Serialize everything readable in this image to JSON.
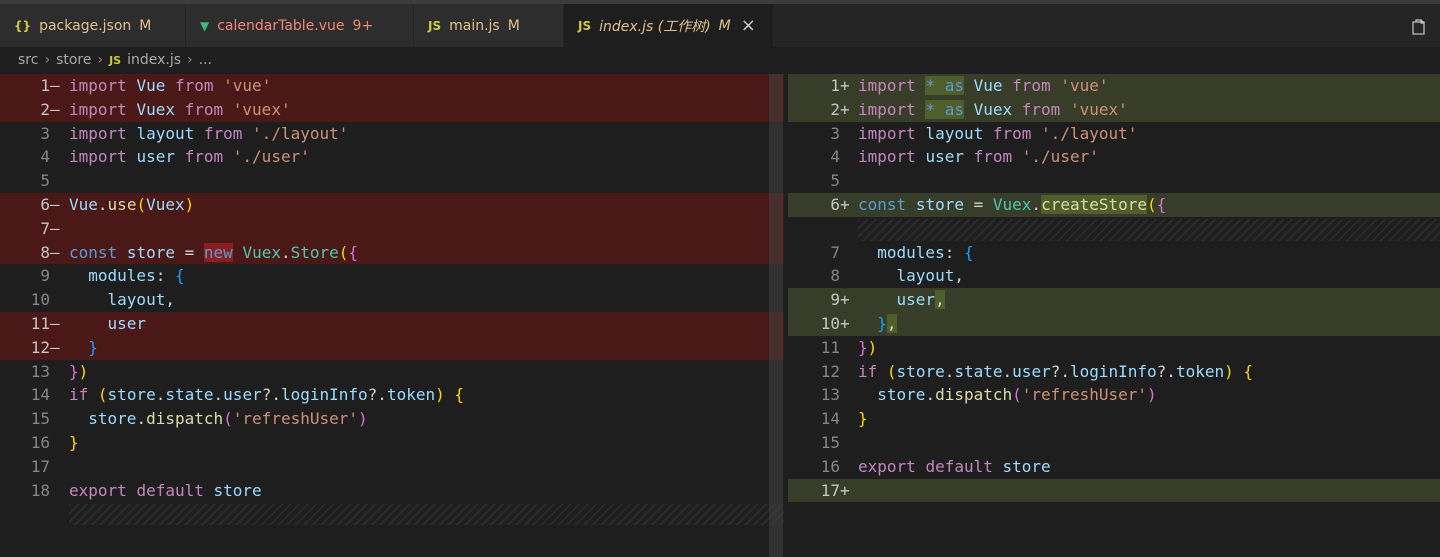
{
  "tabs": [
    {
      "icon": "{}",
      "label": "package.json",
      "status": "M",
      "icon_color": "#cbcb41",
      "label_color": "#e2c08d",
      "status_color": "#e2c08d"
    },
    {
      "icon": "▼",
      "label": "calendarTable.vue",
      "status": "9+",
      "icon_color": "#41b883",
      "label_color": "#f48771",
      "status_color": "#f48771"
    },
    {
      "icon": "JS",
      "label": "main.js",
      "status": "M",
      "icon_color": "#cbcb41",
      "label_color": "#e2c08d",
      "status_color": "#e2c08d"
    },
    {
      "icon": "JS",
      "label": "index.js (工作树)",
      "status": "M",
      "icon_color": "#cbcb41",
      "label_color": "#e2c08d",
      "status_color": "#e2c08d",
      "close": "×"
    }
  ],
  "breadcrumb": {
    "parts": [
      "src",
      "store"
    ],
    "file_icon": "JS",
    "file": "index.js",
    "tail": "..."
  },
  "left": {
    "lines": [
      {
        "n": "1",
        "m": "—",
        "cls": "del"
      },
      {
        "n": "2",
        "m": "—",
        "cls": "del"
      },
      {
        "n": "3"
      },
      {
        "n": "4"
      },
      {
        "n": "5"
      },
      {
        "n": "6",
        "m": "—",
        "cls": "del"
      },
      {
        "n": "7",
        "m": "—",
        "cls": "del"
      },
      {
        "n": "8",
        "m": "—",
        "cls": "del"
      },
      {
        "n": "9"
      },
      {
        "n": "10"
      },
      {
        "n": "11",
        "m": "—",
        "cls": "del"
      },
      {
        "n": "12",
        "m": "—",
        "cls": "del"
      },
      {
        "n": "13"
      },
      {
        "n": "14"
      },
      {
        "n": "15"
      },
      {
        "n": "16"
      },
      {
        "n": "17"
      },
      {
        "n": "18"
      }
    ],
    "code": [
      [
        [
          "kw2",
          "import"
        ],
        [
          "plain",
          " "
        ],
        [
          "var",
          "Vue"
        ],
        [
          "plain",
          " "
        ],
        [
          "kw2",
          "from"
        ],
        [
          "plain",
          " "
        ],
        [
          "str",
          "'vue'"
        ]
      ],
      [
        [
          "kw2",
          "import"
        ],
        [
          "plain",
          " "
        ],
        [
          "var",
          "Vuex"
        ],
        [
          "plain",
          " "
        ],
        [
          "kw2",
          "from"
        ],
        [
          "plain",
          " "
        ],
        [
          "str",
          "'vuex'"
        ]
      ],
      [
        [
          "kw2",
          "import"
        ],
        [
          "plain",
          " "
        ],
        [
          "var",
          "layout"
        ],
        [
          "plain",
          " "
        ],
        [
          "kw2",
          "from"
        ],
        [
          "plain",
          " "
        ],
        [
          "str",
          "'./layout'"
        ]
      ],
      [
        [
          "kw2",
          "import"
        ],
        [
          "plain",
          " "
        ],
        [
          "var",
          "user"
        ],
        [
          "plain",
          " "
        ],
        [
          "kw2",
          "from"
        ],
        [
          "plain",
          " "
        ],
        [
          "str",
          "'./user'"
        ]
      ],
      [],
      [
        [
          "var",
          "Vue"
        ],
        [
          "plain",
          "."
        ],
        [
          "fn",
          "use"
        ],
        [
          "br1",
          "("
        ],
        [
          "var",
          "Vuex"
        ],
        [
          "br1",
          ")"
        ]
      ],
      [],
      [
        [
          "kw",
          "const"
        ],
        [
          "plain",
          " "
        ],
        [
          "var",
          "store"
        ],
        [
          "plain",
          " = "
        ],
        [
          "kw hl-del",
          "new"
        ],
        [
          "plain",
          " "
        ],
        [
          "cls",
          "Vuex"
        ],
        [
          "plain",
          "."
        ],
        [
          "cls",
          "Store"
        ],
        [
          "br1",
          "("
        ],
        [
          "br2",
          "{"
        ]
      ],
      [
        [
          "plain",
          "  "
        ],
        [
          "var",
          "modules"
        ],
        [
          "plain",
          ": "
        ],
        [
          "br3",
          "{"
        ]
      ],
      [
        [
          "plain",
          "    "
        ],
        [
          "var",
          "layout"
        ],
        [
          "plain",
          ","
        ]
      ],
      [
        [
          "plain",
          "    "
        ],
        [
          "var",
          "user"
        ]
      ],
      [
        [
          "plain",
          "  "
        ],
        [
          "br3",
          "}"
        ]
      ],
      [
        [
          "br2",
          "}"
        ],
        [
          "br1",
          ")"
        ]
      ],
      [
        [
          "kw2",
          "if"
        ],
        [
          "plain",
          " "
        ],
        [
          "br1",
          "("
        ],
        [
          "var",
          "store"
        ],
        [
          "plain",
          "."
        ],
        [
          "var",
          "state"
        ],
        [
          "plain",
          "."
        ],
        [
          "var",
          "user"
        ],
        [
          "plain",
          "?."
        ],
        [
          "var",
          "loginInfo"
        ],
        [
          "plain",
          "?."
        ],
        [
          "var",
          "token"
        ],
        [
          "br1",
          ")"
        ],
        [
          "plain",
          " "
        ],
        [
          "br1",
          "{"
        ]
      ],
      [
        [
          "plain",
          "  "
        ],
        [
          "var",
          "store"
        ],
        [
          "plain",
          "."
        ],
        [
          "fn",
          "dispatch"
        ],
        [
          "br2",
          "("
        ],
        [
          "str",
          "'refreshUser'"
        ],
        [
          "br2",
          ")"
        ]
      ],
      [
        [
          "br1",
          "}"
        ]
      ],
      [],
      [
        [
          "kw2",
          "export"
        ],
        [
          "plain",
          " "
        ],
        [
          "kw2",
          "default"
        ],
        [
          "plain",
          " "
        ],
        [
          "var",
          "store"
        ]
      ]
    ]
  },
  "right": {
    "lines": [
      {
        "n": "1",
        "m": "+",
        "cls": "ins"
      },
      {
        "n": "2",
        "m": "+",
        "cls": "ins"
      },
      {
        "n": "3"
      },
      {
        "n": "4"
      },
      {
        "n": "5"
      },
      {
        "n": "6",
        "m": "+",
        "cls": "ins"
      },
      {
        "n": "",
        "hatch": true
      },
      {
        "n": "7"
      },
      {
        "n": "8"
      },
      {
        "n": "9",
        "m": "+",
        "cls": "ins"
      },
      {
        "n": "10",
        "m": "+",
        "cls": "ins"
      },
      {
        "n": "11"
      },
      {
        "n": "12"
      },
      {
        "n": "13"
      },
      {
        "n": "14"
      },
      {
        "n": "15"
      },
      {
        "n": "16"
      },
      {
        "n": "17",
        "m": "+",
        "cls": "ins"
      }
    ],
    "code": [
      [
        [
          "kw2",
          "import"
        ],
        [
          "plain",
          " "
        ],
        [
          "kw hl-ins",
          "* as"
        ],
        [
          "plain",
          " "
        ],
        [
          "var",
          "Vue"
        ],
        [
          "plain",
          " "
        ],
        [
          "kw2",
          "from"
        ],
        [
          "plain",
          " "
        ],
        [
          "str",
          "'vue'"
        ]
      ],
      [
        [
          "kw2",
          "import"
        ],
        [
          "plain",
          " "
        ],
        [
          "kw hl-ins",
          "* as"
        ],
        [
          "plain",
          " "
        ],
        [
          "var",
          "Vuex"
        ],
        [
          "plain",
          " "
        ],
        [
          "kw2",
          "from"
        ],
        [
          "plain",
          " "
        ],
        [
          "str",
          "'vuex'"
        ]
      ],
      [
        [
          "kw2",
          "import"
        ],
        [
          "plain",
          " "
        ],
        [
          "var",
          "layout"
        ],
        [
          "plain",
          " "
        ],
        [
          "kw2",
          "from"
        ],
        [
          "plain",
          " "
        ],
        [
          "str",
          "'./layout'"
        ]
      ],
      [
        [
          "kw2",
          "import"
        ],
        [
          "plain",
          " "
        ],
        [
          "var",
          "user"
        ],
        [
          "plain",
          " "
        ],
        [
          "kw2",
          "from"
        ],
        [
          "plain",
          " "
        ],
        [
          "str",
          "'./user'"
        ]
      ],
      [],
      [
        [
          "kw",
          "const"
        ],
        [
          "plain",
          " "
        ],
        [
          "var",
          "store"
        ],
        [
          "plain",
          " = "
        ],
        [
          "cls",
          "Vuex"
        ],
        [
          "plain",
          "."
        ],
        [
          "fn hl-ins",
          "createStore"
        ],
        [
          "br1",
          "("
        ],
        [
          "br2",
          "{"
        ]
      ],
      [],
      [
        [
          "plain",
          "  "
        ],
        [
          "var",
          "modules"
        ],
        [
          "plain",
          ": "
        ],
        [
          "br3",
          "{"
        ]
      ],
      [
        [
          "plain",
          "    "
        ],
        [
          "var",
          "layout"
        ],
        [
          "plain",
          ","
        ]
      ],
      [
        [
          "plain",
          "    "
        ],
        [
          "var",
          "user"
        ],
        [
          "plain hl-ins",
          ","
        ]
      ],
      [
        [
          "plain",
          "  "
        ],
        [
          "br3",
          "}"
        ],
        [
          "plain hl-ins",
          ","
        ]
      ],
      [
        [
          "br2",
          "}"
        ],
        [
          "br1",
          ")"
        ]
      ],
      [
        [
          "kw2",
          "if"
        ],
        [
          "plain",
          " "
        ],
        [
          "br1",
          "("
        ],
        [
          "var",
          "store"
        ],
        [
          "plain",
          "."
        ],
        [
          "var",
          "state"
        ],
        [
          "plain",
          "."
        ],
        [
          "var",
          "user"
        ],
        [
          "plain",
          "?."
        ],
        [
          "var",
          "loginInfo"
        ],
        [
          "plain",
          "?."
        ],
        [
          "var",
          "token"
        ],
        [
          "br1",
          ")"
        ],
        [
          "plain",
          " "
        ],
        [
          "br1",
          "{"
        ]
      ],
      [
        [
          "plain",
          "  "
        ],
        [
          "var",
          "store"
        ],
        [
          "plain",
          "."
        ],
        [
          "fn",
          "dispatch"
        ],
        [
          "br2",
          "("
        ],
        [
          "str",
          "'refreshUser'"
        ],
        [
          "br2",
          ")"
        ]
      ],
      [
        [
          "br1",
          "}"
        ]
      ],
      [],
      [
        [
          "kw2",
          "export"
        ],
        [
          "plain",
          " "
        ],
        [
          "kw2",
          "default"
        ],
        [
          "plain",
          " "
        ],
        [
          "var",
          "store"
        ]
      ],
      []
    ]
  }
}
